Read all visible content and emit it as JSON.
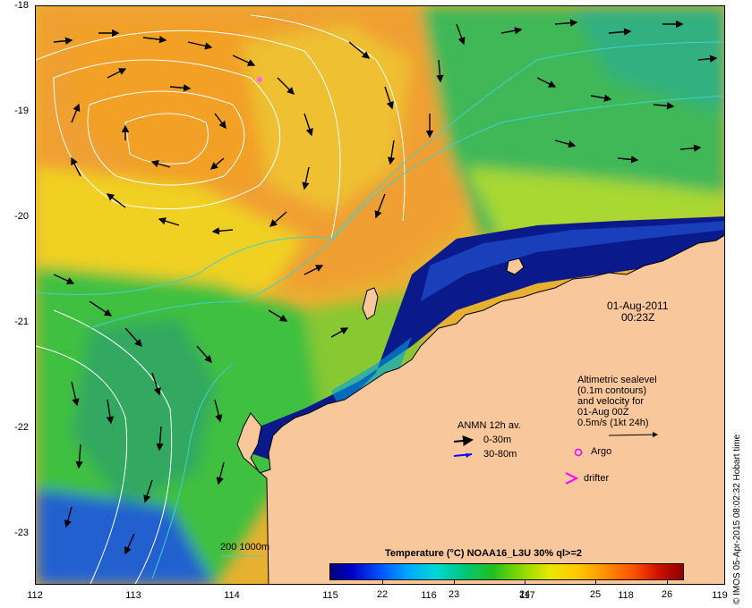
{
  "axes": {
    "x_ticks": [
      "112",
      "113",
      "114",
      "115",
      "116",
      "117",
      "118",
      "119"
    ],
    "y_ticks": [
      "-18",
      "-19",
      "-20",
      "-21",
      "-22",
      "-23"
    ]
  },
  "annotations": {
    "date": "01-Aug-2011",
    "time": "00:23Z",
    "altimetry": [
      "Altimetric sealevel",
      "(0.1m contours)",
      "and velocity for",
      "01-Aug 00Z",
      "0.5m/s (1kt 24h)"
    ],
    "anmn_title": "ANMN 12h av.",
    "anmn_0_30": "0-30m",
    "anmn_30_80": "30-80m",
    "argo": "Argo",
    "drifter": "drifter",
    "isobath": "200  1000m"
  },
  "colorbar": {
    "title": "Temperature (°C) NOAA16_L3U 30% ql>=2",
    "ticks": [
      "22",
      "23",
      "24",
      "25",
      "26"
    ]
  },
  "credit": "© IMOS 05-Apr-2015 08:02:32 Hobart time",
  "colors": {
    "land": "#f9c79c",
    "warm": "#f0a030",
    "cold": "#0a1a8a",
    "mid": "#40c040",
    "arrow": "#000000",
    "isobath": "#40d0d0",
    "argo": "#ff00ff"
  }
}
